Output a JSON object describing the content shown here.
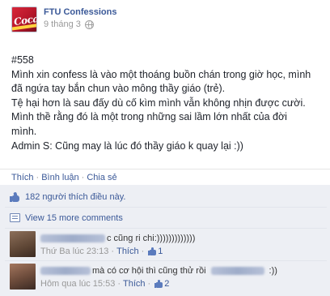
{
  "post": {
    "page_name": "FTU Confessions",
    "date": "9 tháng 3",
    "avatar_icon": "coca-cola-logo-icon",
    "avatar_logo_text": "Coca",
    "privacy_icon": "globe-icon",
    "body_lines": [
      "#558",
      "Mình xin confess là vào một thoáng buồn chán trong giờ học, mình",
      "đã ngứa tay bắn chun vào mông thầy giáo (trẻ).",
      "Tệ hại hơn là sau đấy dù cố kìm mình vẫn không nhịn được cười.",
      "Mình thề rằng đó là một trong những sai lầm lớn nhất của đời",
      "mình.",
      "Admin S: Cũng may là lúc đó thầy giáo k quay lại :))"
    ]
  },
  "actions": {
    "like": "Thích",
    "comment": "Bình luận",
    "share": "Chia sẻ",
    "separator": "·"
  },
  "feedback": {
    "likes_text": "182 người thích điều này.",
    "view_more": "View 15 more comments"
  },
  "comments": [
    {
      "author": "Phuong Tu",
      "text": "c cũng ri chi:)))))))))))))",
      "time": "Thứ Ba lúc 23:13",
      "like_label": "Thích",
      "like_count": "1"
    },
    {
      "author": "Phuong Nhi",
      "text": "mà có cơ hội thì cũng thử rồi",
      "author_tag": "Phuong Tu",
      "text_tail": ":))",
      "time": "Hôm qua lúc 15:53",
      "like_label": "Thích",
      "like_count": "2"
    }
  ],
  "colors": {
    "link": "#3b5998",
    "feedback_bg": "#edeff4",
    "meta": "#999999"
  }
}
